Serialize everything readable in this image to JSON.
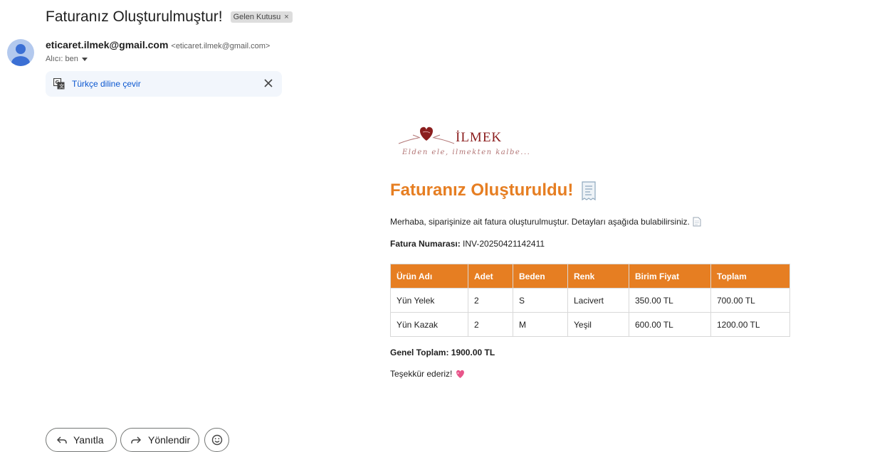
{
  "email": {
    "subject": "Faturanız Oluşturulmuştur!",
    "label_chip": "Gelen Kutusu",
    "label_chip_close": "×",
    "sender_name": "eticaret.ilmek@gmail.com",
    "sender_email": "<eticaret.ilmek@gmail.com>",
    "recipient": "Alıcı: ben",
    "avatar_icon": "person-icon",
    "translate": {
      "icon": "translate-icon",
      "link": "Türkçe diline çevir",
      "close_icon": "close-icon"
    }
  },
  "body": {
    "logo": {
      "brand": "İLMEK",
      "tagline": "Elden ele, ilmekten kalbe...",
      "icon": "heart-hands-logo"
    },
    "title": "Faturanız Oluşturuldu!",
    "title_icon": "receipt-icon",
    "intro": "Merhaba, siparişinize ait fatura oluşturulmuştur. Detayları aşağıda bulabilirsiniz.",
    "intro_icon": "document-icon",
    "invoice_label": "Fatura Numarası:",
    "invoice_value": "INV-20250421142411",
    "table": {
      "headers": [
        "Ürün Adı",
        "Adet",
        "Beden",
        "Renk",
        "Birim Fiyat",
        "Toplam"
      ],
      "rows": [
        [
          "Yün Yelek",
          "2",
          "S",
          "Lacivert",
          "350.00 TL",
          "700.00 TL"
        ],
        [
          "Yün Kazak",
          "2",
          "M",
          "Yeşil",
          "600.00 TL",
          "1200.00 TL"
        ]
      ]
    },
    "grand_total": "Genel Toplam: 1900.00 TL",
    "thanks": "Teşekkür ederiz!",
    "thanks_icon": "sparkling-heart-icon"
  },
  "actions": {
    "reply": "Yanıtla",
    "forward": "Yönlendir",
    "reply_icon": "reply-arrow-icon",
    "forward_icon": "forward-arrow-icon",
    "emoji_icon": "emoji-icon"
  },
  "colors": {
    "accent": "#e67e22",
    "link": "#0b57d0",
    "brand": "#8b1e1e",
    "translate_bg": "#f2f6fc"
  }
}
